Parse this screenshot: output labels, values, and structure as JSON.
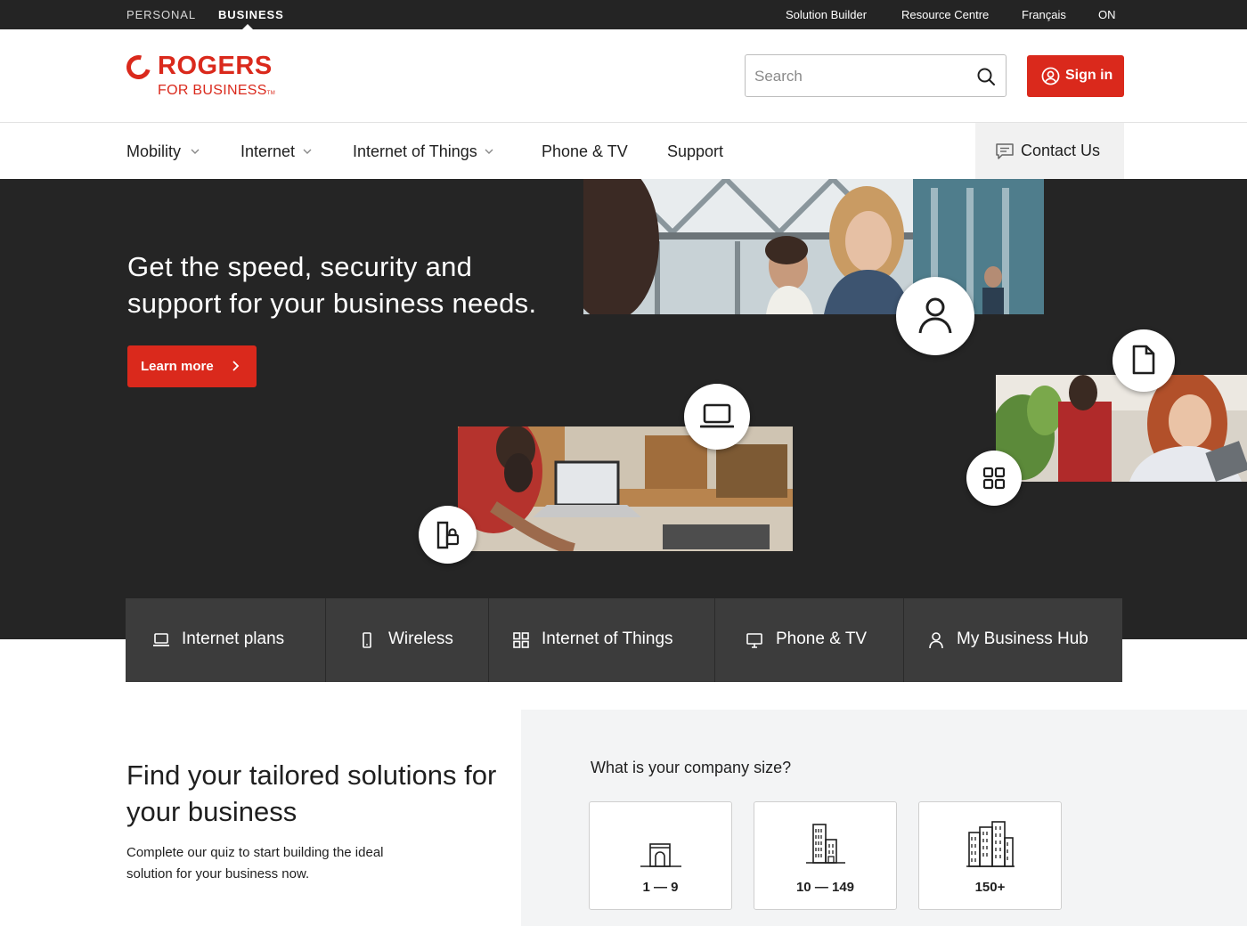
{
  "topbar": {
    "segments": [
      "PERSONAL",
      "BUSINESS"
    ],
    "utility_links": [
      "Solution Builder",
      "Resource Centre",
      "Français",
      "ON"
    ]
  },
  "header": {
    "logo_word": "ROGERS",
    "logo_sub": "FOR BUSINESS",
    "logo_tm": "TM",
    "search_placeholder": "Search",
    "sign_in": "Sign in"
  },
  "nav": {
    "items": [
      "Mobility",
      "Internet",
      "Internet of Things",
      "Phone & TV",
      "Support"
    ],
    "contact": "Contact Us"
  },
  "hero": {
    "headline": "Get the speed, security and support for your business needs.",
    "cta": "Learn more"
  },
  "quick_links": [
    "Internet plans",
    "Wireless",
    "Internet of Things",
    "Phone & TV",
    "My Business Hub"
  ],
  "solutions": {
    "heading": "Find your tailored solutions for your business",
    "body": "Complete our quiz to start building the ideal solution for your business now.",
    "question": "What is your company size?",
    "sizes": [
      "1 — 9",
      "10 — 149",
      "150+"
    ]
  },
  "colors": {
    "brand_red": "#da291c",
    "dark_bg": "#252525",
    "quick_bar": "#3c3c3c",
    "panel_grey": "#f3f4f5"
  },
  "icons": [
    "search-icon",
    "user-circle-icon",
    "chevron-down-icon",
    "chat-icon",
    "chevron-right-icon",
    "person-icon",
    "document-icon",
    "laptop-icon",
    "grid-icon",
    "mobile-lock-icon",
    "monitor-icon",
    "building-small-icon",
    "building-medium-icon",
    "building-large-icon"
  ]
}
